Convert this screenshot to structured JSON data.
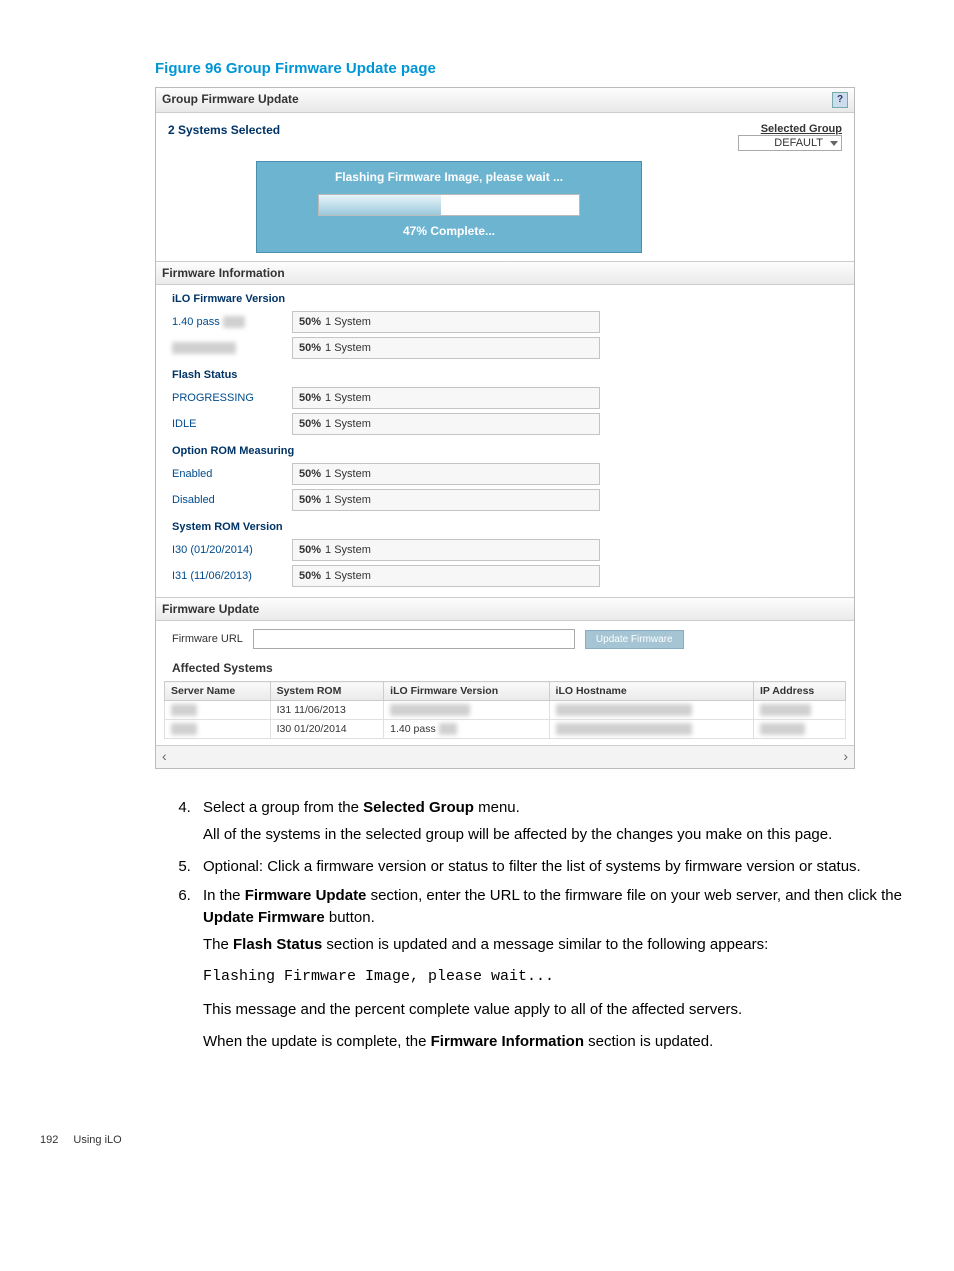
{
  "figure_title": "Figure 96 Group Firmware Update page",
  "panel_title": "Group Firmware Update",
  "help_icon": "?",
  "systems_selected": "2 Systems Selected",
  "selected_group": {
    "label": "Selected Group",
    "value": "DEFAULT"
  },
  "flashing": {
    "message": "Flashing Firmware Image, please wait ...",
    "percent_text": "47% Complete...",
    "percent": 47
  },
  "firmware_info_title": "Firmware Information",
  "ilo_version": {
    "heading": "iLO Firmware Version",
    "rows": [
      {
        "label": "1.40 pass",
        "bar": "50% 1 System"
      },
      {
        "label": "",
        "bar": "50% 1 System"
      }
    ]
  },
  "flash_status": {
    "heading": "Flash Status",
    "rows": [
      {
        "label": "PROGRESSING",
        "bar": "50% 1 System"
      },
      {
        "label": "IDLE",
        "bar": "50% 1 System"
      }
    ]
  },
  "option_rom": {
    "heading": "Option ROM Measuring",
    "rows": [
      {
        "label": "Enabled",
        "bar": "50% 1 System"
      },
      {
        "label": "Disabled",
        "bar": "50% 1 System"
      }
    ]
  },
  "system_rom": {
    "heading": "System ROM Version",
    "rows": [
      {
        "label": "I30 (01/20/2014)",
        "bar": "50% 1 System"
      },
      {
        "label": "I31 (11/06/2013)",
        "bar": "50% 1 System"
      }
    ]
  },
  "fw_update": {
    "title": "Firmware Update",
    "url_label": "Firmware URL",
    "url_value": "",
    "button": "Update Firmware"
  },
  "affected": {
    "title": "Affected Systems",
    "cols": [
      "Server Name",
      "System ROM",
      "iLO Firmware Version",
      "iLO Hostname",
      "IP Address"
    ],
    "rows": [
      {
        "server": "",
        "rom": "I31 11/06/2013",
        "ilofw": "",
        "host": "",
        "ip": ""
      },
      {
        "server": "",
        "rom": "I30 01/20/2014",
        "ilofw": "1.40 pass",
        "host": "",
        "ip": ""
      }
    ]
  },
  "steps": {
    "s4a": "Select a group from the ",
    "s4b": "Selected Group",
    "s4c": " menu.",
    "s4p": "All of the systems in the selected group will be affected by the changes you make on this page.",
    "s5": "Optional: Click a firmware version or status to filter the list of systems by firmware version or status.",
    "s6a": "In the ",
    "s6b": "Firmware Update",
    "s6c": " section, enter the URL to the firmware file on your web server, and then click the ",
    "s6d": "Update Firmware",
    "s6e": " button.",
    "s6p1a": "The ",
    "s6p1b": "Flash Status",
    "s6p1c": " section is updated and a message similar to the following appears:",
    "s6code": "Flashing Firmware Image, please wait...",
    "s6p2": "This message and the percent complete value apply to all of the affected servers.",
    "s6p3a": "When the update is complete, the ",
    "s6p3b": "Firmware Information",
    "s6p3c": " section is updated."
  },
  "footer": {
    "page": "192",
    "section": "Using iLO"
  }
}
